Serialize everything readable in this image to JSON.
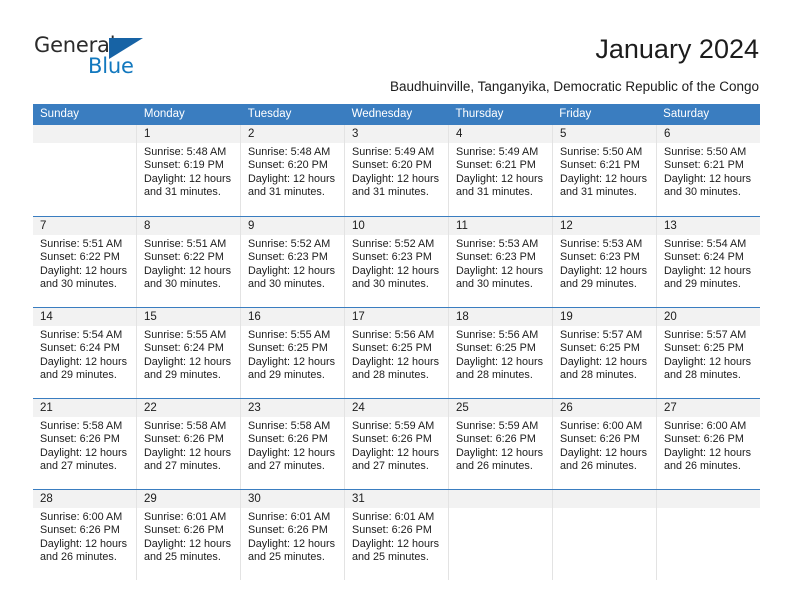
{
  "brand": {
    "name_part1": "General",
    "name_part2": "Blue",
    "accent_color": "#1763a5",
    "text_color": "#1278be",
    "triangle_icon": "triangle-logo-icon"
  },
  "header": {
    "title": "January 2024",
    "subtitle": "Baudhuinville, Tanganyika, Democratic Republic of the Congo"
  },
  "calendar": {
    "header_bg": "#3a7dc0",
    "header_text_color": "#ffffff",
    "daynumber_bg": "#f2f2f2",
    "weekdays": [
      "Sunday",
      "Monday",
      "Tuesday",
      "Wednesday",
      "Thursday",
      "Friday",
      "Saturday"
    ],
    "weeks": [
      [
        {
          "empty": true
        },
        {
          "day": "1",
          "sunrise": "Sunrise: 5:48 AM",
          "sunset": "Sunset: 6:19 PM",
          "daylight_line1": "Daylight: 12 hours",
          "daylight_line2": "and 31 minutes."
        },
        {
          "day": "2",
          "sunrise": "Sunrise: 5:48 AM",
          "sunset": "Sunset: 6:20 PM",
          "daylight_line1": "Daylight: 12 hours",
          "daylight_line2": "and 31 minutes."
        },
        {
          "day": "3",
          "sunrise": "Sunrise: 5:49 AM",
          "sunset": "Sunset: 6:20 PM",
          "daylight_line1": "Daylight: 12 hours",
          "daylight_line2": "and 31 minutes."
        },
        {
          "day": "4",
          "sunrise": "Sunrise: 5:49 AM",
          "sunset": "Sunset: 6:21 PM",
          "daylight_line1": "Daylight: 12 hours",
          "daylight_line2": "and 31 minutes."
        },
        {
          "day": "5",
          "sunrise": "Sunrise: 5:50 AM",
          "sunset": "Sunset: 6:21 PM",
          "daylight_line1": "Daylight: 12 hours",
          "daylight_line2": "and 31 minutes."
        },
        {
          "day": "6",
          "sunrise": "Sunrise: 5:50 AM",
          "sunset": "Sunset: 6:21 PM",
          "daylight_line1": "Daylight: 12 hours",
          "daylight_line2": "and 30 minutes."
        }
      ],
      [
        {
          "day": "7",
          "sunrise": "Sunrise: 5:51 AM",
          "sunset": "Sunset: 6:22 PM",
          "daylight_line1": "Daylight: 12 hours",
          "daylight_line2": "and 30 minutes."
        },
        {
          "day": "8",
          "sunrise": "Sunrise: 5:51 AM",
          "sunset": "Sunset: 6:22 PM",
          "daylight_line1": "Daylight: 12 hours",
          "daylight_line2": "and 30 minutes."
        },
        {
          "day": "9",
          "sunrise": "Sunrise: 5:52 AM",
          "sunset": "Sunset: 6:23 PM",
          "daylight_line1": "Daylight: 12 hours",
          "daylight_line2": "and 30 minutes."
        },
        {
          "day": "10",
          "sunrise": "Sunrise: 5:52 AM",
          "sunset": "Sunset: 6:23 PM",
          "daylight_line1": "Daylight: 12 hours",
          "daylight_line2": "and 30 minutes."
        },
        {
          "day": "11",
          "sunrise": "Sunrise: 5:53 AM",
          "sunset": "Sunset: 6:23 PM",
          "daylight_line1": "Daylight: 12 hours",
          "daylight_line2": "and 30 minutes."
        },
        {
          "day": "12",
          "sunrise": "Sunrise: 5:53 AM",
          "sunset": "Sunset: 6:23 PM",
          "daylight_line1": "Daylight: 12 hours",
          "daylight_line2": "and 29 minutes."
        },
        {
          "day": "13",
          "sunrise": "Sunrise: 5:54 AM",
          "sunset": "Sunset: 6:24 PM",
          "daylight_line1": "Daylight: 12 hours",
          "daylight_line2": "and 29 minutes."
        }
      ],
      [
        {
          "day": "14",
          "sunrise": "Sunrise: 5:54 AM",
          "sunset": "Sunset: 6:24 PM",
          "daylight_line1": "Daylight: 12 hours",
          "daylight_line2": "and 29 minutes."
        },
        {
          "day": "15",
          "sunrise": "Sunrise: 5:55 AM",
          "sunset": "Sunset: 6:24 PM",
          "daylight_line1": "Daylight: 12 hours",
          "daylight_line2": "and 29 minutes."
        },
        {
          "day": "16",
          "sunrise": "Sunrise: 5:55 AM",
          "sunset": "Sunset: 6:25 PM",
          "daylight_line1": "Daylight: 12 hours",
          "daylight_line2": "and 29 minutes."
        },
        {
          "day": "17",
          "sunrise": "Sunrise: 5:56 AM",
          "sunset": "Sunset: 6:25 PM",
          "daylight_line1": "Daylight: 12 hours",
          "daylight_line2": "and 28 minutes."
        },
        {
          "day": "18",
          "sunrise": "Sunrise: 5:56 AM",
          "sunset": "Sunset: 6:25 PM",
          "daylight_line1": "Daylight: 12 hours",
          "daylight_line2": "and 28 minutes."
        },
        {
          "day": "19",
          "sunrise": "Sunrise: 5:57 AM",
          "sunset": "Sunset: 6:25 PM",
          "daylight_line1": "Daylight: 12 hours",
          "daylight_line2": "and 28 minutes."
        },
        {
          "day": "20",
          "sunrise": "Sunrise: 5:57 AM",
          "sunset": "Sunset: 6:25 PM",
          "daylight_line1": "Daylight: 12 hours",
          "daylight_line2": "and 28 minutes."
        }
      ],
      [
        {
          "day": "21",
          "sunrise": "Sunrise: 5:58 AM",
          "sunset": "Sunset: 6:26 PM",
          "daylight_line1": "Daylight: 12 hours",
          "daylight_line2": "and 27 minutes."
        },
        {
          "day": "22",
          "sunrise": "Sunrise: 5:58 AM",
          "sunset": "Sunset: 6:26 PM",
          "daylight_line1": "Daylight: 12 hours",
          "daylight_line2": "and 27 minutes."
        },
        {
          "day": "23",
          "sunrise": "Sunrise: 5:58 AM",
          "sunset": "Sunset: 6:26 PM",
          "daylight_line1": "Daylight: 12 hours",
          "daylight_line2": "and 27 minutes."
        },
        {
          "day": "24",
          "sunrise": "Sunrise: 5:59 AM",
          "sunset": "Sunset: 6:26 PM",
          "daylight_line1": "Daylight: 12 hours",
          "daylight_line2": "and 27 minutes."
        },
        {
          "day": "25",
          "sunrise": "Sunrise: 5:59 AM",
          "sunset": "Sunset: 6:26 PM",
          "daylight_line1": "Daylight: 12 hours",
          "daylight_line2": "and 26 minutes."
        },
        {
          "day": "26",
          "sunrise": "Sunrise: 6:00 AM",
          "sunset": "Sunset: 6:26 PM",
          "daylight_line1": "Daylight: 12 hours",
          "daylight_line2": "and 26 minutes."
        },
        {
          "day": "27",
          "sunrise": "Sunrise: 6:00 AM",
          "sunset": "Sunset: 6:26 PM",
          "daylight_line1": "Daylight: 12 hours",
          "daylight_line2": "and 26 minutes."
        }
      ],
      [
        {
          "day": "28",
          "sunrise": "Sunrise: 6:00 AM",
          "sunset": "Sunset: 6:26 PM",
          "daylight_line1": "Daylight: 12 hours",
          "daylight_line2": "and 26 minutes."
        },
        {
          "day": "29",
          "sunrise": "Sunrise: 6:01 AM",
          "sunset": "Sunset: 6:26 PM",
          "daylight_line1": "Daylight: 12 hours",
          "daylight_line2": "and 25 minutes."
        },
        {
          "day": "30",
          "sunrise": "Sunrise: 6:01 AM",
          "sunset": "Sunset: 6:26 PM",
          "daylight_line1": "Daylight: 12 hours",
          "daylight_line2": "and 25 minutes."
        },
        {
          "day": "31",
          "sunrise": "Sunrise: 6:01 AM",
          "sunset": "Sunset: 6:26 PM",
          "daylight_line1": "Daylight: 12 hours",
          "daylight_line2": "and 25 minutes."
        },
        {
          "empty": true
        },
        {
          "empty": true
        },
        {
          "empty": true
        }
      ]
    ]
  }
}
